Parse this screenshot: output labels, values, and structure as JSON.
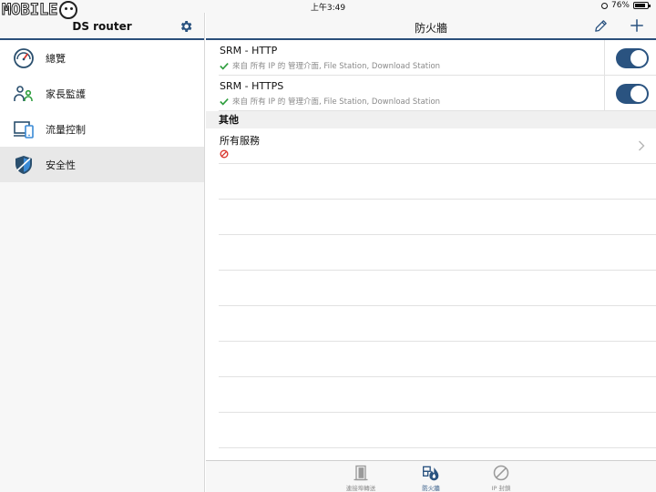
{
  "status": {
    "time": "上午3:49",
    "battery": "76%"
  },
  "watermark": {
    "text": "MOBILE"
  },
  "sidebar": {
    "title": "DS router",
    "items": [
      {
        "label": "總覽",
        "icon": "dashboard-icon"
      },
      {
        "label": "家長監護",
        "icon": "parental-control-icon"
      },
      {
        "label": "流量控制",
        "icon": "traffic-control-icon"
      },
      {
        "label": "安全性",
        "icon": "shield-icon",
        "active": true
      }
    ]
  },
  "main": {
    "title": "防火牆",
    "rules": [
      {
        "name": "SRM - HTTP",
        "desc": "來自 所有 IP 的 管理介面, File Station, Download Station",
        "enabled": true
      },
      {
        "name": "SRM - HTTPS",
        "desc": "來自 所有 IP 的 管理介面, File Station, Download Station",
        "enabled": true
      }
    ],
    "section": "其他",
    "service": {
      "name": "所有服務",
      "status": "blocked"
    }
  },
  "tabs": [
    {
      "label": "連接埠轉送",
      "icon": "port-forward-icon"
    },
    {
      "label": "防火牆",
      "icon": "firewall-icon",
      "active": true
    },
    {
      "label": "IP 封鎖",
      "icon": "ip-block-icon"
    }
  ],
  "colors": {
    "accent": "#2a5380",
    "check": "#2e9e3e",
    "block": "#d9342b"
  }
}
